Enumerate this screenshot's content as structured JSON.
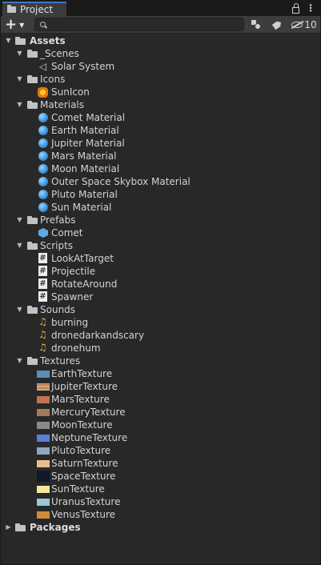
{
  "window": {
    "tab_label": "Project",
    "hidden_count": "10"
  },
  "search": {
    "value": "",
    "placeholder": ""
  },
  "icons": {
    "folder": "folder-icon",
    "lock": "lock-icon",
    "menu": "kebab-menu-icon",
    "add": "plus-icon",
    "search": "search-icon",
    "filter_type": "filter-by-type-icon",
    "filter_label": "filter-by-label-icon",
    "hidden_packages": "eye-slash-icon"
  },
  "tree": {
    "assets": "Assets",
    "scenes": {
      "label": "_Scenes",
      "items": [
        "Solar System"
      ]
    },
    "icons_folder": {
      "label": "Icons",
      "items": [
        "SunIcon"
      ]
    },
    "materials": {
      "label": "Materials",
      "items": [
        "Comet Material",
        "Earth Material",
        "Jupiter Material",
        "Mars Material",
        "Moon Material",
        "Outer Space Skybox Material",
        "Pluto Material",
        "Sun Material"
      ]
    },
    "prefabs": {
      "label": "Prefabs",
      "items": [
        "Comet"
      ]
    },
    "scripts": {
      "label": "Scripts",
      "items": [
        "LookAtTarget",
        "Projectile",
        "RotateAround",
        "Spawner"
      ]
    },
    "sounds": {
      "label": "Sounds",
      "items": [
        "burning",
        "dronedarkandscary",
        "dronehum"
      ]
    },
    "textures": {
      "label": "Textures",
      "items": [
        "EarthTexture",
        "JupiterTexture",
        "MarsTexture",
        "MercuryTexture",
        "MoonTexture",
        "NeptuneTexture",
        "PlutoTexture",
        "SaturnTexture",
        "SpaceTexture",
        "SunTexture",
        "UranusTexture",
        "VenusTexture"
      ]
    },
    "packages": "Packages"
  },
  "colors": {
    "background": "#282828",
    "toolbar": "#3c3c3c",
    "tab_accent": "#3a79bb",
    "material": "#3b90d8",
    "sound": "#e6b53c",
    "texture_earth": "#5c8fb8",
    "texture_jupiter": "#d9a87c",
    "texture_mars": "#c27553",
    "texture_mercury": "#a07a5c",
    "texture_moon": "#8a8a8a",
    "texture_neptune": "#5b7fd8",
    "texture_pluto": "#8fa6bd",
    "texture_saturn": "#e4c08f",
    "texture_space": "#10182a",
    "texture_sun": "#f7e59a",
    "texture_uranus": "#9ec6d6",
    "texture_venus": "#d08a3a"
  }
}
